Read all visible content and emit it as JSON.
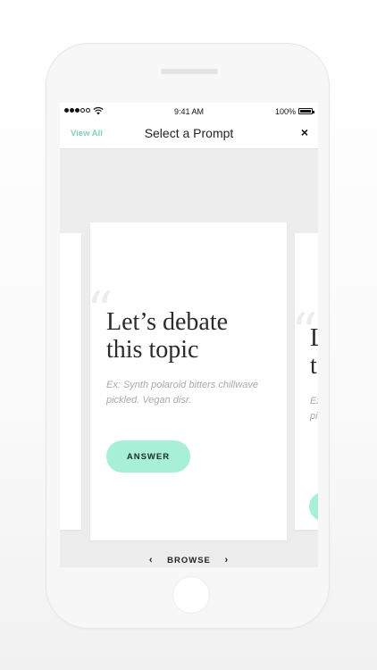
{
  "status_bar": {
    "time": "9:41 AM",
    "battery_pct": "100%"
  },
  "nav": {
    "view_all": "View All",
    "title": "Select a Prompt",
    "close": "×"
  },
  "card": {
    "quote": "“",
    "prompt_line1": "Let’s debate",
    "prompt_line2": "this topic",
    "example": "Ex: Synth polaroid bitters chillwave pickled. Vegan disr.",
    "answer_label": "ANSWER"
  },
  "peek_card": {
    "prompt_line1": "L",
    "prompt_line2": "t",
    "example_line1": "Ex",
    "example_line2": "pi"
  },
  "browse": {
    "label": "BROWSE",
    "prev": "‹",
    "next": "›"
  },
  "colors": {
    "accent": "#7fd3b8",
    "button": "#a8efd8",
    "screen_bg": "#ededed"
  }
}
